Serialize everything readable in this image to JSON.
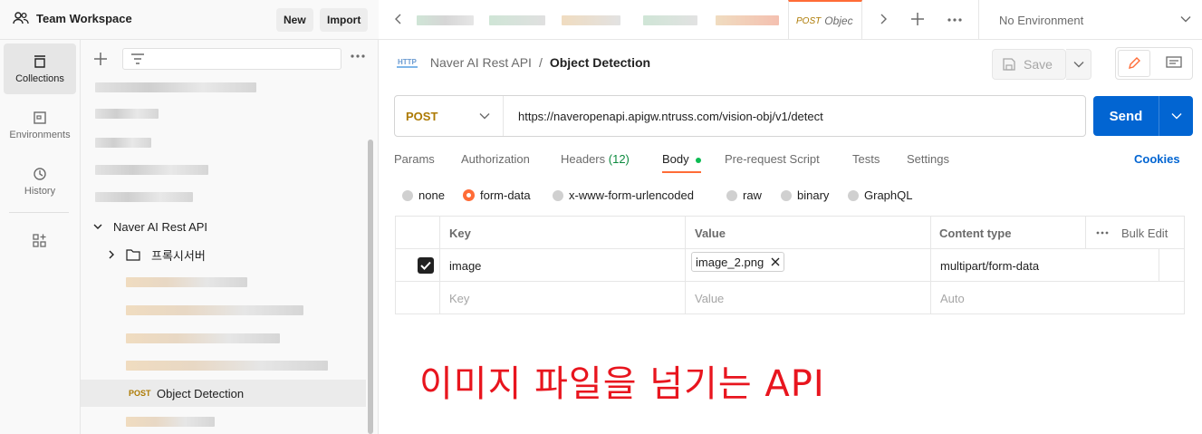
{
  "workspace": {
    "title": "Team Workspace",
    "new_label": "New",
    "import_label": "Import"
  },
  "rail": {
    "items": [
      {
        "label": "Collections",
        "icon": "collections-icon",
        "active": true
      },
      {
        "label": "Environments",
        "icon": "environments-icon",
        "active": false
      },
      {
        "label": "History",
        "icon": "history-icon",
        "active": false
      }
    ],
    "apps_icon": "apps-icon"
  },
  "sidebar": {
    "collection_name": "Naver AI Rest API",
    "folder_name": "프록시서버",
    "selected_request": {
      "method": "POST",
      "name": "Object Detection"
    }
  },
  "tabs": {
    "active_tab": {
      "method": "POST",
      "name": "Objec"
    },
    "environment": "No Environment"
  },
  "request": {
    "breadcrumb_parent": "Naver AI Rest API",
    "breadcrumb_sep": "/",
    "breadcrumb_current": "Object Detection",
    "http_badge": "HTTP",
    "save_label": "Save",
    "method": "POST",
    "url": "https://naveropenapi.apigw.ntruss.com/vision-obj/v1/detect",
    "send_label": "Send",
    "tabs": {
      "params": "Params",
      "authorization": "Authorization",
      "headers": "Headers",
      "headers_count": "(12)",
      "body": "Body",
      "prerequest": "Pre-request Script",
      "tests": "Tests",
      "settings": "Settings"
    },
    "cookies_label": "Cookies",
    "body_modes": {
      "none": "none",
      "form_data": "form-data",
      "urlencoded": "x-www-form-urlencoded",
      "raw": "raw",
      "binary": "binary",
      "graphql": "GraphQL"
    },
    "table": {
      "headers": {
        "key": "Key",
        "value": "Value",
        "content_type": "Content type",
        "bulk_edit": "Bulk Edit"
      },
      "row": {
        "key": "image",
        "value": "image_2.png",
        "content_type": "multipart/form-data"
      },
      "placeholder": {
        "key": "Key",
        "value": "Value",
        "content_type": "Auto"
      }
    }
  },
  "annotation": "이미지 파일을 넘기는 API",
  "colors": {
    "accent": "#ff6c37",
    "send_blue": "#0265d2",
    "post_orange": "#ad7a03",
    "annotation_red": "#e8151e"
  }
}
